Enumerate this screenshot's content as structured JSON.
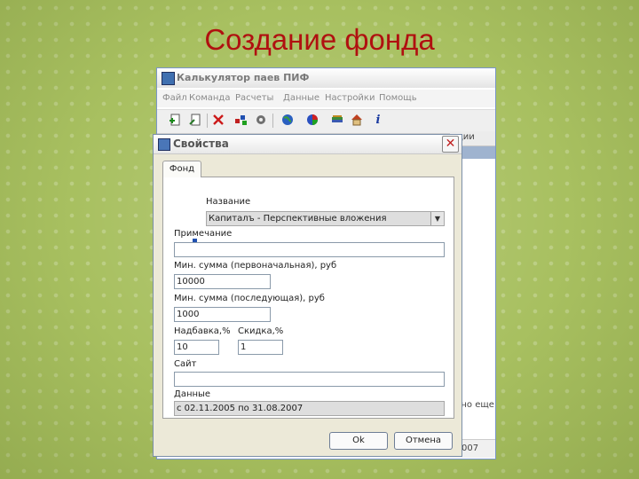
{
  "slide": {
    "title": "Создание фонда"
  },
  "main_window": {
    "title": "Калькулятор паев ПИФ",
    "menu": [
      "Файл",
      "Команда",
      "Расчеты",
      "Данные",
      "Настройки",
      "Помощь"
    ],
    "column_header_fragment": "ции",
    "side_text_fragment": "лно еще",
    "status_fragment": "007",
    "toolbar_icons": [
      "add-document-icon",
      "edit-document-icon",
      "delete-icon",
      "fund-icon",
      "gear-icon",
      "globe-icon",
      "chart-icon",
      "books-icon",
      "house-icon",
      "info-icon"
    ]
  },
  "dialog": {
    "title": "Свойства",
    "close_symbol": "✕",
    "tab_label": "Фонд",
    "name_label": "Название",
    "name_value": "Капиталъ - Перспективные вложения",
    "note_label": "Примечание",
    "note_value": "",
    "min_first_label": "Мин. сумма (первоначальная), руб",
    "min_first_value": "10000",
    "min_next_label": "Мин. сумма (последующая), руб",
    "min_next_value": "1000",
    "markup_label": "Надбавка,%",
    "markup_value": "10",
    "discount_label": "Скидка,%",
    "discount_value": "1",
    "site_label": "Сайт",
    "site_value": "",
    "data_label": "Данные",
    "data_value": "с 02.11.2005 по 31.08.2007",
    "ok_label": "Ok",
    "cancel_label": "Отмена"
  }
}
